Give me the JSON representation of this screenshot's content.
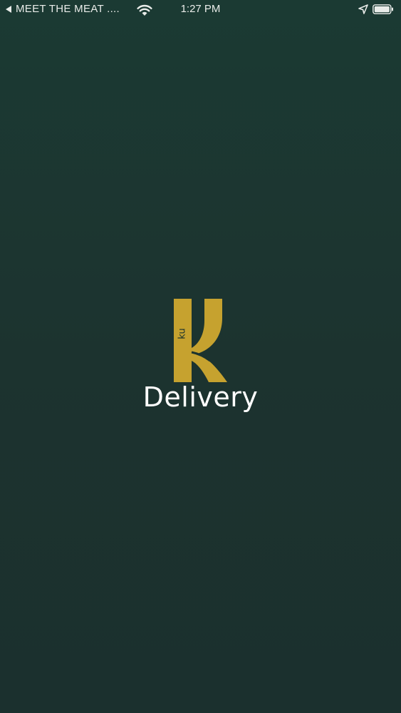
{
  "status_bar": {
    "back_label": "MEET THE MEAT ....",
    "time": "1:27 PM",
    "icons": [
      "back-triangle-icon",
      "wifi-icon",
      "location-arrow-icon",
      "battery-icon"
    ]
  },
  "splash": {
    "logo_letters": "ku",
    "wordmark": "Delivery"
  },
  "colors": {
    "background": "#1c332f",
    "accent_gold": "#c6a22f",
    "text": "#ffffff"
  }
}
